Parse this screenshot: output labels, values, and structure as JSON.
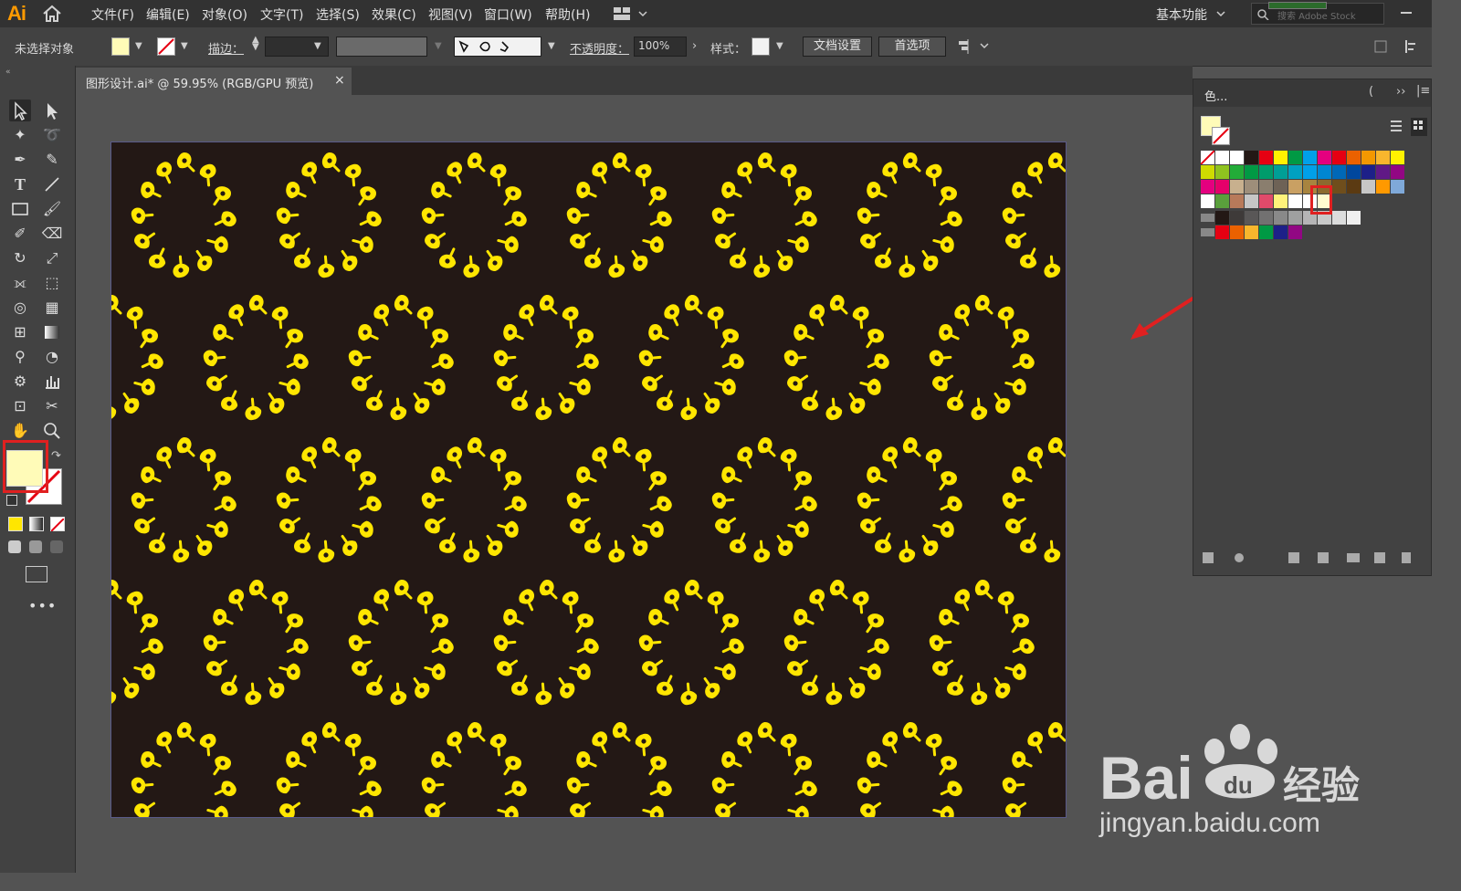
{
  "app": {
    "logo": "Ai"
  },
  "menu": [
    "文件(F)",
    "编辑(E)",
    "对象(O)",
    "文字(T)",
    "选择(S)",
    "效果(C)",
    "视图(V)",
    "窗口(W)",
    "帮助(H)"
  ],
  "workspace": {
    "label": "基本功能"
  },
  "search": {
    "placeholder": "搜索 Adobe Stock"
  },
  "control_bar": {
    "selection_status": "未选择对象",
    "stroke_label": "描边：",
    "opacity_label": "不透明度：",
    "opacity_value": "100%",
    "style_label": "样式：",
    "doc_setup_button": "文档设置",
    "preferences_button": "首选项"
  },
  "document_tab": {
    "title": "图形设计.ai* @ 59.95% (RGB/GPU 预览)",
    "close": "×"
  },
  "swatches_panel": {
    "title": "色..."
  },
  "colors": {
    "menubar": "#323232",
    "panel": "#424242",
    "canvas": "#535353",
    "artboard_bg": "#231815",
    "motif": "#ffe600",
    "highlight_box": "#e02020",
    "arrow": "#e02020"
  },
  "swatch_rows": [
    [
      "none",
      "#ffffff",
      "#ffffff",
      "#231815",
      "#e60012",
      "#fff100",
      "#009944",
      "#00a0e9",
      "#e4007f",
      "#e60012",
      "#eb6100",
      "#f39800",
      "#f8b62d",
      "#fff100"
    ],
    [
      "#cfdb00",
      "#8fc31f",
      "#22ac38",
      "#009944",
      "#009b6b",
      "#009e96",
      "#00a0c1",
      "#00a0e9",
      "#0086d1",
      "#0068b7",
      "#00479d",
      "#1d2088",
      "#601986",
      "#920783"
    ],
    [
      "#e4007f",
      "#e5006a",
      "#c8b08e",
      "#9e8e7a",
      "#8a7e6e",
      "#6e6256",
      "#c9a063",
      "#a8843f",
      "#8c6a2f",
      "#6f4e1c",
      "#5b3a12",
      "#c7c7c7",
      "#ff9900",
      "#7fa9d9"
    ],
    [
      "#ffffff",
      "#5aa03c",
      "#b87a5a",
      "#c6c6c6",
      "#e04a6a",
      "#fff27a",
      "#ffffff",
      "#ffffff",
      "#fffbd0"
    ],
    [
      "#231815",
      "#3e3a39",
      "#595757",
      "#727171",
      "#898989",
      "#9fa0a0",
      "#b5b5b6",
      "#c9caca",
      "#dcdddd",
      "#efefef"
    ],
    [
      "#e60012",
      "#eb6100",
      "#f8b62d",
      "#009944",
      "#1d2088",
      "#920783"
    ]
  ],
  "watermark": {
    "url": "jingyan.baidu.com"
  }
}
